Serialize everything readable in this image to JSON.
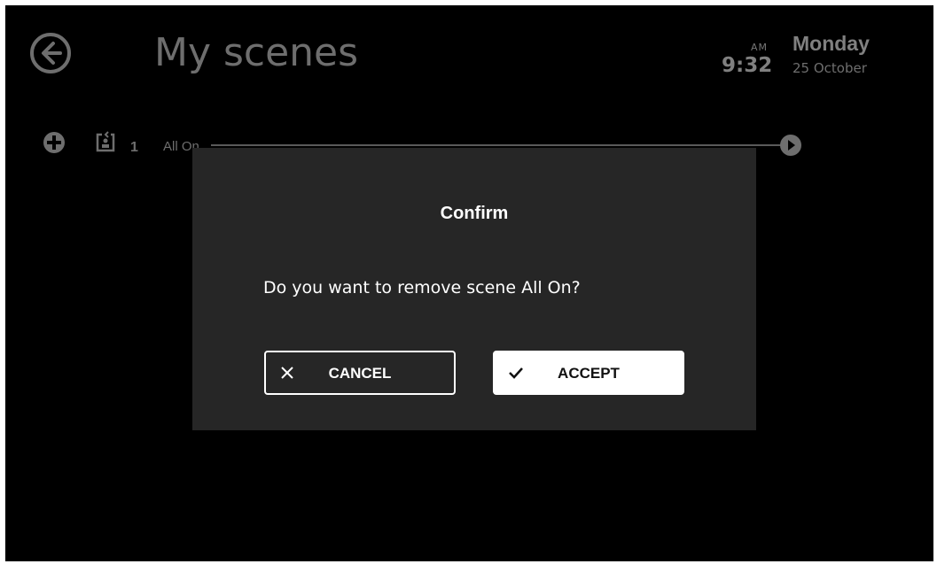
{
  "header": {
    "back_icon": "arrow-left-circle-icon",
    "title": "My scenes",
    "clock": {
      "ampm": "AM",
      "time": "9:32",
      "day": "Monday",
      "date": "25 October"
    }
  },
  "scene_row": {
    "add_icon": "plus-circle-icon",
    "scene_icon": "scene-person-icon",
    "count": "1",
    "name": "All On",
    "play_icon": "play-circle-icon"
  },
  "dialog": {
    "title": "Confirm",
    "message": "Do you want to remove scene All On?",
    "cancel_label": "CANCEL",
    "cancel_icon": "close-icon",
    "accept_label": "ACCEPT",
    "accept_icon": "checkmark-icon"
  },
  "colors": {
    "background": "#000000",
    "dialog_background": "#262626",
    "dim_text": "#6e6e6e",
    "button_primary": "#ffffff"
  }
}
